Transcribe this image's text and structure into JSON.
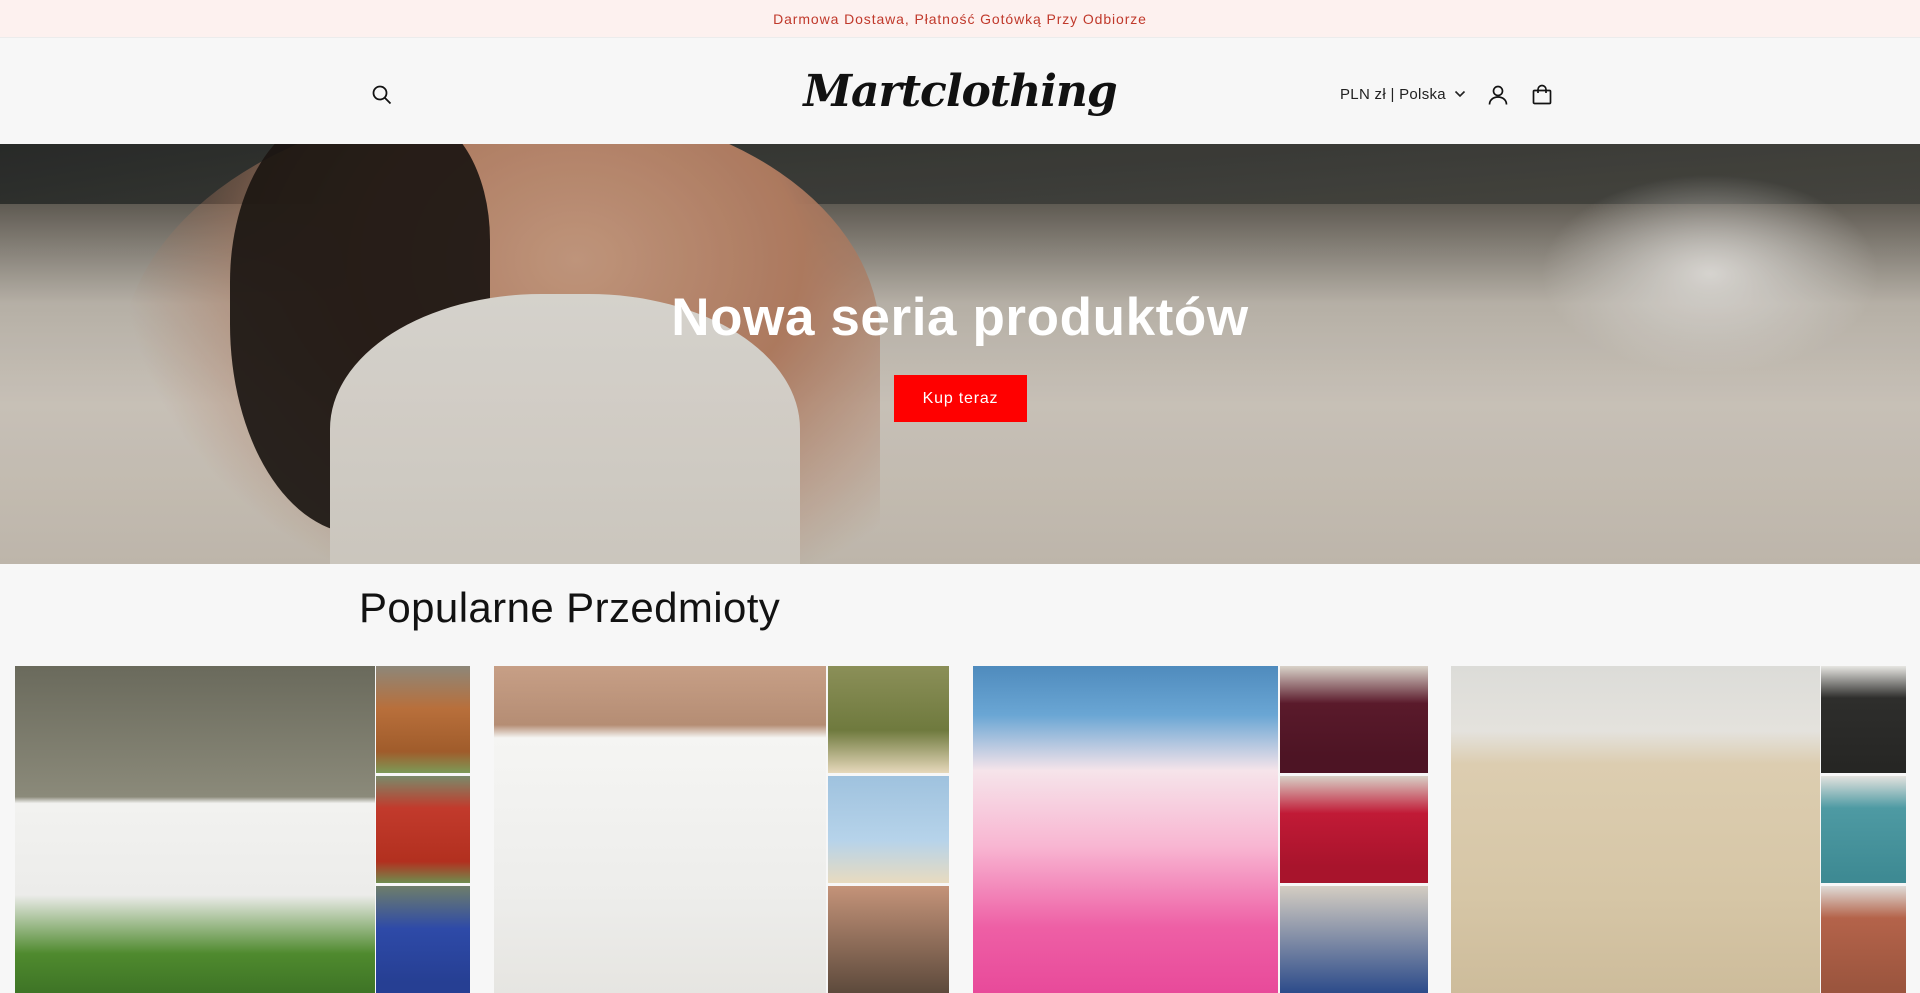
{
  "announcement": {
    "text": "Darmowa Dostawa, Płatność Gotówką Przy Odbiorze"
  },
  "header": {
    "logo_text": "Martclothing",
    "currency_label": "PLN zł | Polska",
    "icons": [
      "search-icon",
      "chevron-down-icon",
      "account-icon",
      "cart-icon"
    ]
  },
  "hero": {
    "title": "Nowa seria produktów",
    "button_label": "Kup teraz"
  },
  "featured": {
    "title": "Popularne Przedmioty",
    "products": [
      {
        "image": "white-linen-dress"
      },
      {
        "image": "white-linen-cargo-pants"
      },
      {
        "image": "pink-ombre-swimsuit"
      },
      {
        "image": "beige-linen-set"
      }
    ]
  },
  "colors": {
    "accent": "#ff0000",
    "announcement_text": "#c0392b",
    "announcement_bg": "#fdf1ef"
  }
}
